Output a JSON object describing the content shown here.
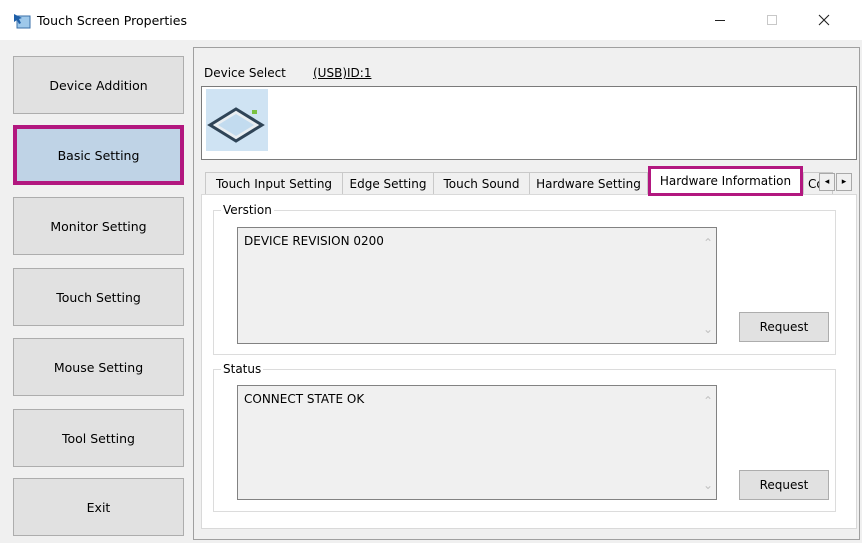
{
  "window": {
    "title": "Touch Screen Properties",
    "icon": "touch-screen-app-icon",
    "controls": {
      "minimize": "—",
      "maximize": "☐",
      "close": "✕"
    }
  },
  "sidebar": {
    "items": [
      {
        "label": "Device Addition"
      },
      {
        "label": "Basic Setting",
        "selected": true
      },
      {
        "label": "Monitor Setting"
      },
      {
        "label": "Touch Setting"
      },
      {
        "label": "Mouse Setting"
      },
      {
        "label": "Tool Setting"
      },
      {
        "label": "Exit"
      }
    ]
  },
  "device": {
    "select_label": "Device Select",
    "id": "(USB)ID:1",
    "thumbnail_icon": "touch-monitor-icon"
  },
  "tabs": [
    {
      "label": "Touch Input Setting"
    },
    {
      "label": "Edge Setting"
    },
    {
      "label": "Touch Sound"
    },
    {
      "label": "Hardware Setting"
    },
    {
      "label": "Hardware Information",
      "active": true
    },
    {
      "label": "Co"
    }
  ],
  "tab_scroll": {
    "left": "◂",
    "right": "▸"
  },
  "hardware_info": {
    "version": {
      "label": "Verstion",
      "text": "DEVICE REVISION 0200",
      "request_label": "Request"
    },
    "status": {
      "label": "Status",
      "text": "CONNECT STATE OK",
      "request_label": "Request"
    },
    "scroll_arrows": {
      "up": "⌃",
      "down": "⌄"
    }
  },
  "colors": {
    "highlight": "#b2177f",
    "selected_button": "#bfd3e6",
    "button_face": "#e1e1e1",
    "window_bg": "#f0f0f0"
  }
}
